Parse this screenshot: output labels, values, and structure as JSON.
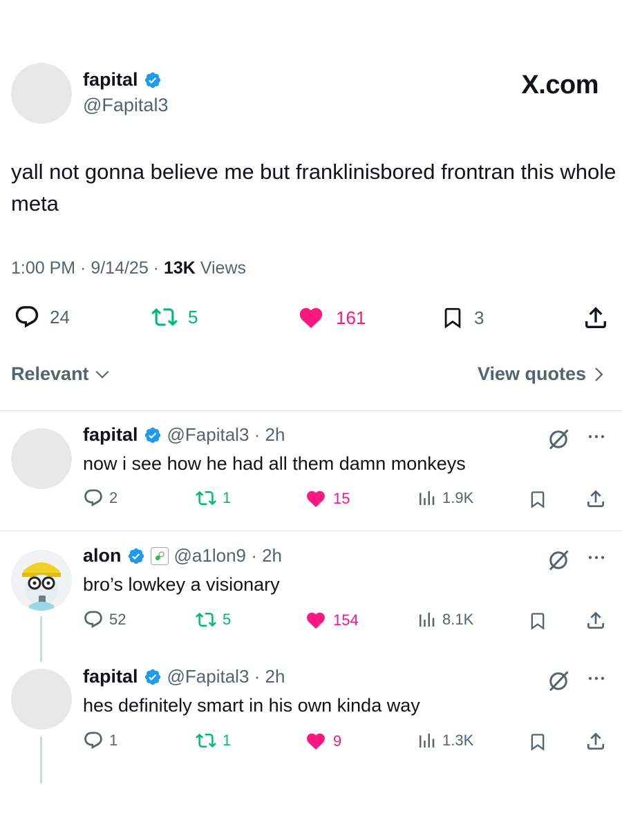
{
  "main_post": {
    "display_name": "fapital",
    "handle": "@Fapital3",
    "site_label": "X.com",
    "text": "yall not gonna believe me but franklinisbored frontran this whole meta",
    "timestamp": "1:00 PM · 9/14/25 · ",
    "views_count": "13K",
    "views_label": " Views",
    "stats": {
      "replies": "24",
      "reposts": "5",
      "likes": "161",
      "bookmarks": "3"
    }
  },
  "sort": {
    "relevant_label": "Relevant",
    "view_quotes_label": "View quotes"
  },
  "replies": [
    {
      "display_name": "fapital",
      "handle_time": "@Fapital3 · 2h",
      "text": "now i see how he had all them damn monkeys",
      "replies": "2",
      "reposts": "1",
      "likes": "15",
      "views": "1.9K"
    },
    {
      "display_name": "alon",
      "handle_time": "@a1lon9 · 2h",
      "text": "bro’s lowkey a visionary",
      "replies": "52",
      "reposts": "5",
      "likes": "154",
      "views": "8.1K"
    },
    {
      "display_name": "fapital",
      "handle_time": "@Fapital3 · 2h",
      "text": "hes definitely smart in his own kinda way",
      "replies": "1",
      "reposts": "1",
      "likes": "9",
      "views": "1.3K"
    }
  ],
  "colors": {
    "verified": "#1d9bf0",
    "repost": "#00ba7c",
    "like": "#f91880",
    "muted": "#536471"
  },
  "icons": [
    "verified-badge-icon",
    "reply-icon",
    "repost-icon",
    "like-icon",
    "bookmark-icon",
    "share-icon",
    "views-icon",
    "grok-icon",
    "more-icon",
    "chevron-down-icon",
    "chevron-right-icon",
    "pill-icon"
  ]
}
